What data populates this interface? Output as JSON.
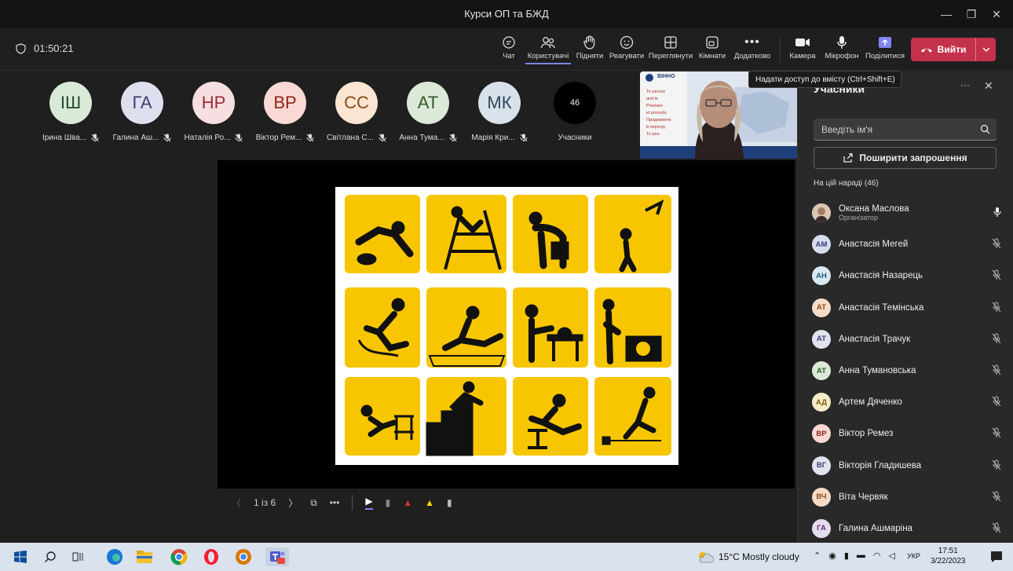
{
  "window": {
    "title": "Курси ОП та БЖД"
  },
  "meeting": {
    "timer": "01:50:21"
  },
  "toolbar": {
    "chat": "Чат",
    "people": "Користувачі",
    "raise": "Підняти",
    "react": "Реагувати",
    "view": "Переглянути",
    "rooms": "Кімнати",
    "more": "Додатково",
    "camera": "Камера",
    "mic": "Мікрофон",
    "share": "Поділитися",
    "leave": "Вийти"
  },
  "tooltip": "Надати доступ до вмісту (Ctrl+Shift+E)",
  "stage_participants": [
    {
      "initials": "ІШ",
      "name": "Ірина Шва...",
      "bg": "#d8ead8",
      "fg": "#244b2e"
    },
    {
      "initials": "ГА",
      "name": "Галина Аш...",
      "bg": "#dfe0ef",
      "fg": "#3a3f73"
    },
    {
      "initials": "НР",
      "name": "Наталія Ро...",
      "bg": "#f6dfe1",
      "fg": "#9c2b3a"
    },
    {
      "initials": "ВР",
      "name": "Віктор Рем...",
      "bg": "#f9d9d4",
      "fg": "#8e2419"
    },
    {
      "initials": "СС",
      "name": "Світлана С...",
      "bg": "#fae5d2",
      "fg": "#8a4b12"
    },
    {
      "initials": "АТ",
      "name": "Анна Тума...",
      "bg": "#dde9d8",
      "fg": "#2f5a26"
    },
    {
      "initials": "МК",
      "name": "Марія Кри...",
      "bg": "#d9e1ea",
      "fg": "#2e4660"
    }
  ],
  "overflow": {
    "count": "46",
    "label": "Учасники"
  },
  "video": {
    "caption": "ВІННО",
    "slide_lines": [
      "То percee",
      "and le",
      "Prestare",
      "el procedu",
      "Продовжити",
      "й перегру",
      "То рен"
    ]
  },
  "presentation": {
    "page": "1 із 6"
  },
  "panel": {
    "title": "Учасники",
    "search_placeholder": "Введіть ім'я",
    "invite": "Поширити запрошення",
    "section": "На цій нараді (46)",
    "list": [
      {
        "initials": "",
        "name": "Оксана Маслова",
        "role": "Організатор",
        "bg": "#c8a58a",
        "fg": "#fff",
        "photo": true,
        "mic": "on"
      },
      {
        "initials": "АМ",
        "name": "Анастасія Мегей",
        "bg": "#d7dbee",
        "fg": "#3a3f73",
        "mic": "off"
      },
      {
        "initials": "АН",
        "name": "Анастасія Назарець",
        "bg": "#d9e8f2",
        "fg": "#1f5f7a",
        "mic": "off"
      },
      {
        "initials": "АТ",
        "name": "Анастасія Темінська",
        "bg": "#f6dcc7",
        "fg": "#8a4b12",
        "mic": "off"
      },
      {
        "initials": "АТ",
        "name": "Анастасія Трачук",
        "bg": "#e1e3ef",
        "fg": "#3a3f73",
        "mic": "off"
      },
      {
        "initials": "АТ",
        "name": "Анна Тумановська",
        "bg": "#dde9d8",
        "fg": "#2f5a26",
        "mic": "off"
      },
      {
        "initials": "АД",
        "name": "Артем Дяченко",
        "bg": "#f7ebc8",
        "fg": "#7a5a08",
        "mic": "off"
      },
      {
        "initials": "ВР",
        "name": "Віктор Ремез",
        "bg": "#f9d9d4",
        "fg": "#8e2419",
        "mic": "off"
      },
      {
        "initials": "ВГ",
        "name": "Вікторія Гладишева",
        "bg": "#e1e3ef",
        "fg": "#3a3f73",
        "mic": "off"
      },
      {
        "initials": "ВЧ",
        "name": "Віта Червяк",
        "bg": "#f6dcc7",
        "fg": "#8a4b12",
        "mic": "off"
      },
      {
        "initials": "ГА",
        "name": "Галина Ашмаріна",
        "bg": "#e6dcef",
        "fg": "#5b2f7a",
        "mic": "off"
      }
    ]
  },
  "taskbar": {
    "weather": "15°C  Mostly cloudy",
    "lang": "УКР",
    "time": "17:51",
    "date": "3/22/2023"
  }
}
